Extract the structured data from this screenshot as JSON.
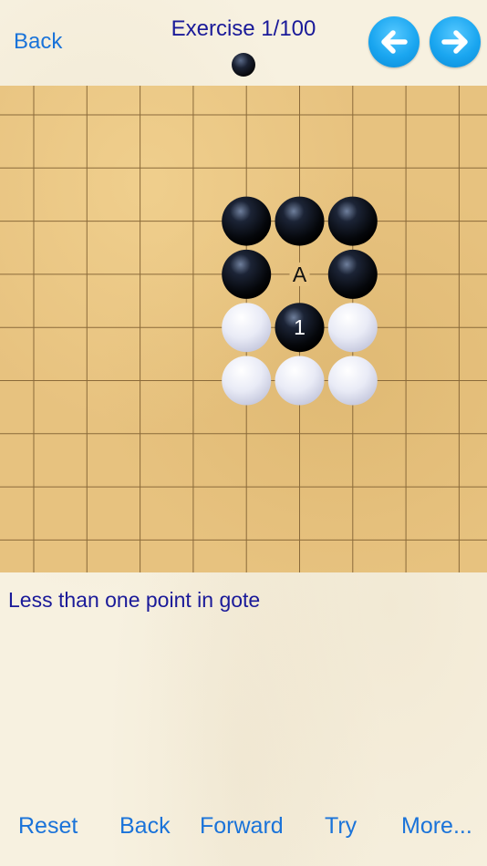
{
  "header": {
    "back_label": "Back",
    "title": "Exercise 1/100",
    "turn_stone": "black",
    "prev_icon": "arrow-left-icon",
    "next_icon": "arrow-right-icon",
    "accent": "#1aa6f0"
  },
  "board": {
    "background": "#e7c27f",
    "line_color": "#8a6a3a",
    "stones": [
      {
        "col": 4,
        "row": 2,
        "color": "black",
        "label": ""
      },
      {
        "col": 5,
        "row": 2,
        "color": "black",
        "label": ""
      },
      {
        "col": 6,
        "row": 2,
        "color": "black",
        "label": ""
      },
      {
        "col": 4,
        "row": 3,
        "color": "black",
        "label": ""
      },
      {
        "col": 6,
        "row": 3,
        "color": "black",
        "label": ""
      },
      {
        "col": 4,
        "row": 4,
        "color": "white",
        "label": ""
      },
      {
        "col": 5,
        "row": 4,
        "color": "black",
        "label": "1"
      },
      {
        "col": 6,
        "row": 4,
        "color": "white",
        "label": ""
      },
      {
        "col": 4,
        "row": 5,
        "color": "white",
        "label": ""
      },
      {
        "col": 5,
        "row": 5,
        "color": "white",
        "label": ""
      },
      {
        "col": 6,
        "row": 5,
        "color": "white",
        "label": ""
      }
    ],
    "marks": [
      {
        "col": 5,
        "row": 3,
        "text": "A"
      }
    ]
  },
  "comment": "Less than one point in gote",
  "toolbar": {
    "reset": "Reset",
    "back": "Back",
    "forward": "Forward",
    "try": "Try",
    "more": "More..."
  }
}
